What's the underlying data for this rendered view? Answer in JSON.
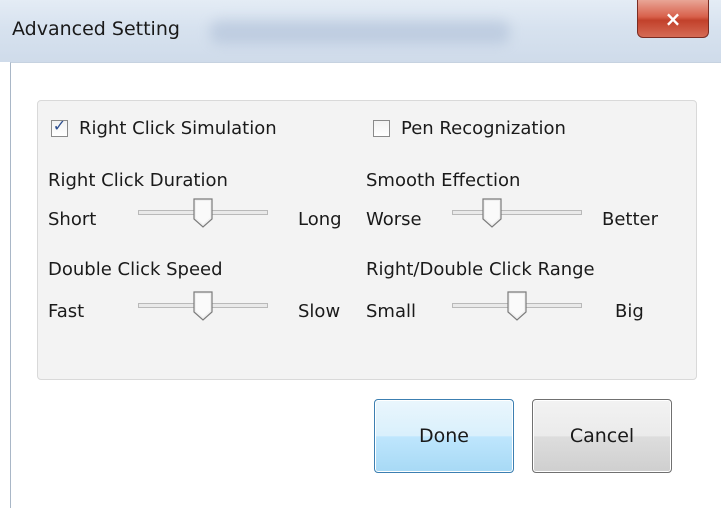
{
  "window": {
    "title": "Advanced Setting",
    "close_symbol": "×"
  },
  "right_click_simulation": {
    "label": "Right Click Simulation",
    "checked": true
  },
  "pen_recognization": {
    "label": "Pen Recognization",
    "checked": false
  },
  "right_click_duration": {
    "title": "Right Click Duration",
    "min_label": "Short",
    "max_label": "Long",
    "value": 0.5
  },
  "smooth_effection": {
    "title": "Smooth Effection",
    "min_label": "Worse",
    "max_label": "Better",
    "value": 0.25
  },
  "double_click_speed": {
    "title": "Double Click Speed",
    "min_label": "Fast",
    "max_label": "Slow",
    "value": 0.5
  },
  "right_double_click_range": {
    "title": "Right/Double Click Range",
    "min_label": "Small",
    "max_label": "Big",
    "value": 0.5
  },
  "buttons": {
    "done": "Done",
    "cancel": "Cancel"
  },
  "colors": {
    "accent": "#3c7fb1",
    "close_button": "#c2412b",
    "checkmark": "#2e4f8f"
  }
}
